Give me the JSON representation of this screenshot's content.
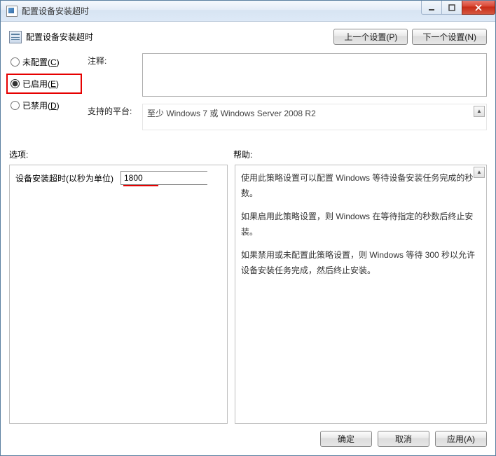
{
  "window": {
    "title": "配置设备安装超时"
  },
  "heading": "配置设备安装超时",
  "nav": {
    "prev": "上一个设置(P)",
    "next": "下一个设置(N)"
  },
  "radios": {
    "not_configured": "未配置(C)",
    "enabled": "已启用(E)",
    "disabled": "已禁用(D)",
    "selected": "enabled"
  },
  "labels": {
    "comment": "注释:",
    "platform": "支持的平台:",
    "options": "选项:",
    "help": "帮助:"
  },
  "platform_text": "至少 Windows 7 或 Windows Server 2008 R2",
  "option": {
    "label": "设备安装超时(以秒为单位)",
    "value": "1800"
  },
  "help_paragraphs": [
    "使用此策略设置可以配置 Windows 等待设备安装任务完成的秒数。",
    "如果启用此策略设置，则 Windows 在等待指定的秒数后终止安装。",
    "如果禁用或未配置此策略设置，则 Windows 等待 300 秒以允许设备安装任务完成，然后终止安装。"
  ],
  "buttons": {
    "ok": "确定",
    "cancel": "取消",
    "apply": "应用(A)"
  }
}
